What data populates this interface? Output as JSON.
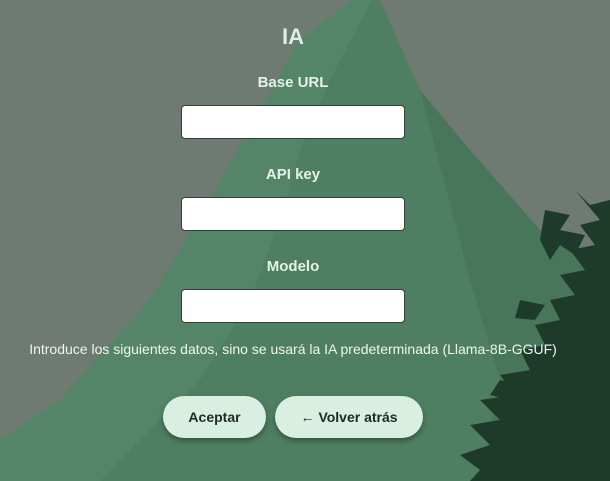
{
  "window": {
    "title": "IA"
  },
  "fields": {
    "base_url": {
      "label": "Base URL",
      "value": "",
      "placeholder": ""
    },
    "api_key": {
      "label": "API key",
      "value": "",
      "placeholder": ""
    },
    "model": {
      "label": "Modelo",
      "value": "",
      "placeholder": ""
    }
  },
  "hint": "Introduce los siguientes datos, sino se usará la IA predeterminada (Llama-8B-GGUF)",
  "buttons": {
    "accept_label": "Aceptar",
    "back_arrow": "←",
    "back_label": "Volver atrás"
  },
  "colors": {
    "background": "#6f7a72",
    "mountain": "#4f7f62",
    "mountain_shadow": "#3f6d52",
    "tree": "#1d3a2b",
    "button_bg": "#d8efe2",
    "title": "#d9efe3"
  },
  "icons": {
    "back": "left-arrow-icon"
  }
}
